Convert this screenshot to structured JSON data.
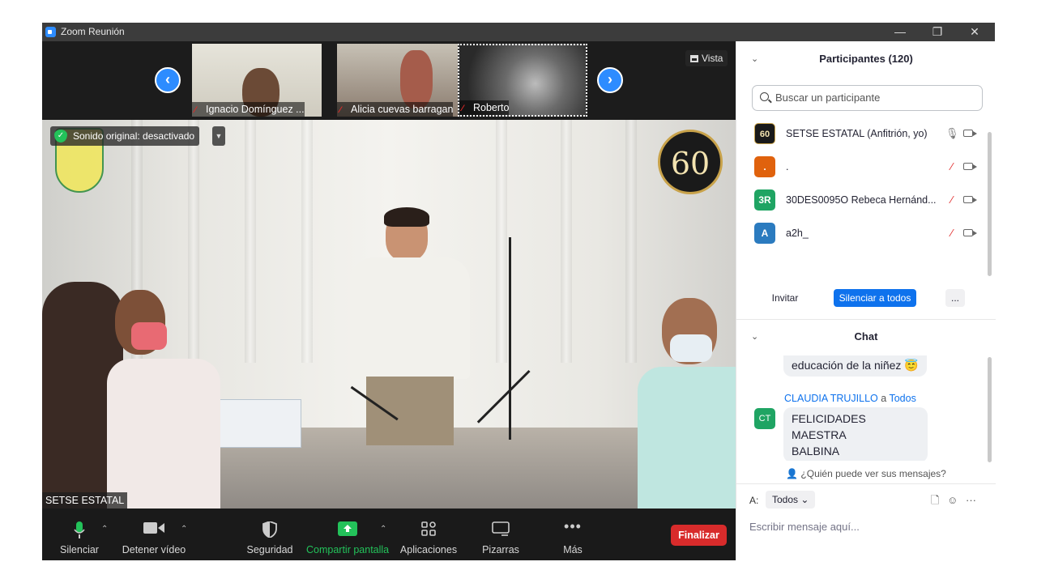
{
  "window": {
    "title": "Zoom Reunión"
  },
  "window_controls": {
    "minimize": "—",
    "restore": "❐",
    "close": "✕"
  },
  "strip": {
    "prev_icon": "‹",
    "next_icon": "›",
    "thumbnails": [
      {
        "name": "Ignacio Domínguez ...",
        "muted": true
      },
      {
        "name": "Alicia cuevas barragan",
        "muted": true
      },
      {
        "name": "Roberto",
        "muted": true
      }
    ],
    "view_label": "Vista"
  },
  "main_video": {
    "sound_badge": "Sonido original: desactivado",
    "speaker_name": "SETSE ESTATAL",
    "logo_text": "60"
  },
  "toolbar": {
    "mute": "Silenciar",
    "stop_video": "Detener vídeo",
    "security": "Seguridad",
    "share_screen": "Compartir pantalla",
    "apps": "Aplicaciones",
    "whiteboards": "Pizarras",
    "more": "Más",
    "end": "Finalizar"
  },
  "participants": {
    "header": "Participantes (120)",
    "search_placeholder": "Buscar un participante",
    "list": [
      {
        "initials": "60",
        "name": "SETSE ESTATAL (Anfitrión, yo)",
        "color": "#1a1a1a",
        "mic": "on"
      },
      {
        "initials": ".",
        "name": ".",
        "color": "#e0620d",
        "mic": "off"
      },
      {
        "initials": "3R",
        "name": "30DES0095O  Rebeca Hernánd...",
        "color": "#1fa463",
        "mic": "off"
      },
      {
        "initials": "A",
        "name": "a2h_",
        "color": "#2b7bbf",
        "mic": "off"
      }
    ],
    "invite": "Invitar",
    "mute_all": "Silenciar a todos",
    "more": "..."
  },
  "chat": {
    "header": "Chat",
    "messages": [
      {
        "text": "educación de la niñez 😇"
      },
      {
        "from": "CLAUDIA TRUJILLO",
        "to_word": "a",
        "to": "Todos",
        "initials": "CT",
        "text_line1": "FELICIDADES MAESTRA",
        "text_line2": "BALBINA"
      }
    ],
    "who_sees": "¿Quién puede ver sus mensajes?",
    "to_label": "A:",
    "to_value": "Todos",
    "compose_placeholder": "Escribir mensaje aquí..."
  },
  "colors": {
    "accent": "#0e72ed",
    "end_red": "#d82b2b",
    "share_green": "#23c25a"
  }
}
